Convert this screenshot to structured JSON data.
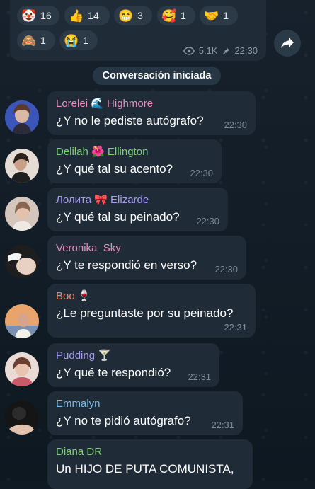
{
  "reactions": [
    {
      "icon": "clown-emoji",
      "emoji": "🤡",
      "count": "16"
    },
    {
      "icon": "thumbs-up-emoji",
      "emoji": "👍",
      "count": "14"
    },
    {
      "icon": "grin-emoji",
      "emoji": "😁",
      "count": "3"
    },
    {
      "icon": "smiling-hearts-emoji",
      "emoji": "🥰",
      "count": "1"
    },
    {
      "icon": "handshake-emoji",
      "emoji": "🤝",
      "count": "1"
    },
    {
      "icon": "see-no-evil-monkey-emoji",
      "emoji": "🙈",
      "count": "1"
    },
    {
      "icon": "crying-emoji",
      "emoji": "😭",
      "count": "1"
    }
  ],
  "post_meta": {
    "views": "5.1K",
    "time": "22:30"
  },
  "service_message": "Conversación iniciada",
  "messages": [
    {
      "sender": "Lorelei 🌊 Highmore",
      "sender_color": "#e58fc0",
      "text": "¿Y no le pediste autógrafo?",
      "time": "22:30",
      "avatar_color": "#3a5fc8"
    },
    {
      "sender": "Delilah 🌺 Ellington",
      "sender_color": "#7fd17a",
      "text": "¿Y qué tal su acento?",
      "time": "22:30",
      "avatar_color": "#d9c9c2"
    },
    {
      "sender": "Лолита 🎀 Elizarde",
      "sender_color": "#a79bf5",
      "text": "¿Y qué tal su peinado?",
      "time": "22:30",
      "avatar_color": "#c9b7b0"
    },
    {
      "sender": "Veronika_Sky",
      "sender_color": "#e58fc0",
      "text": "¿Y te respondió en verso?",
      "time": "22:30",
      "avatar_color": "#2a2a2a"
    },
    {
      "sender": "Boo 🍷",
      "sender_color": "#f08a6b",
      "text": "¿Le preguntaste por su peinado?",
      "time": "22:31",
      "avatar_color": "#d8894d"
    },
    {
      "sender": "Pudding 🍸",
      "sender_color": "#a79bf5",
      "text": "¿Y qué te respondió?",
      "time": "22:31",
      "avatar_color": "#cfa38f"
    },
    {
      "sender": "Emmalyn",
      "sender_color": "#7dbbe8",
      "text": "¿Y no te pidió autógrafo?",
      "time": "22:31",
      "avatar_color": "#1d1d1d"
    },
    {
      "sender": "Diana DR",
      "sender_color": "#7fd17a",
      "text": "Un HIJO DE PUTA COMUNISTA,",
      "time": "",
      "avatar_color": ""
    }
  ]
}
